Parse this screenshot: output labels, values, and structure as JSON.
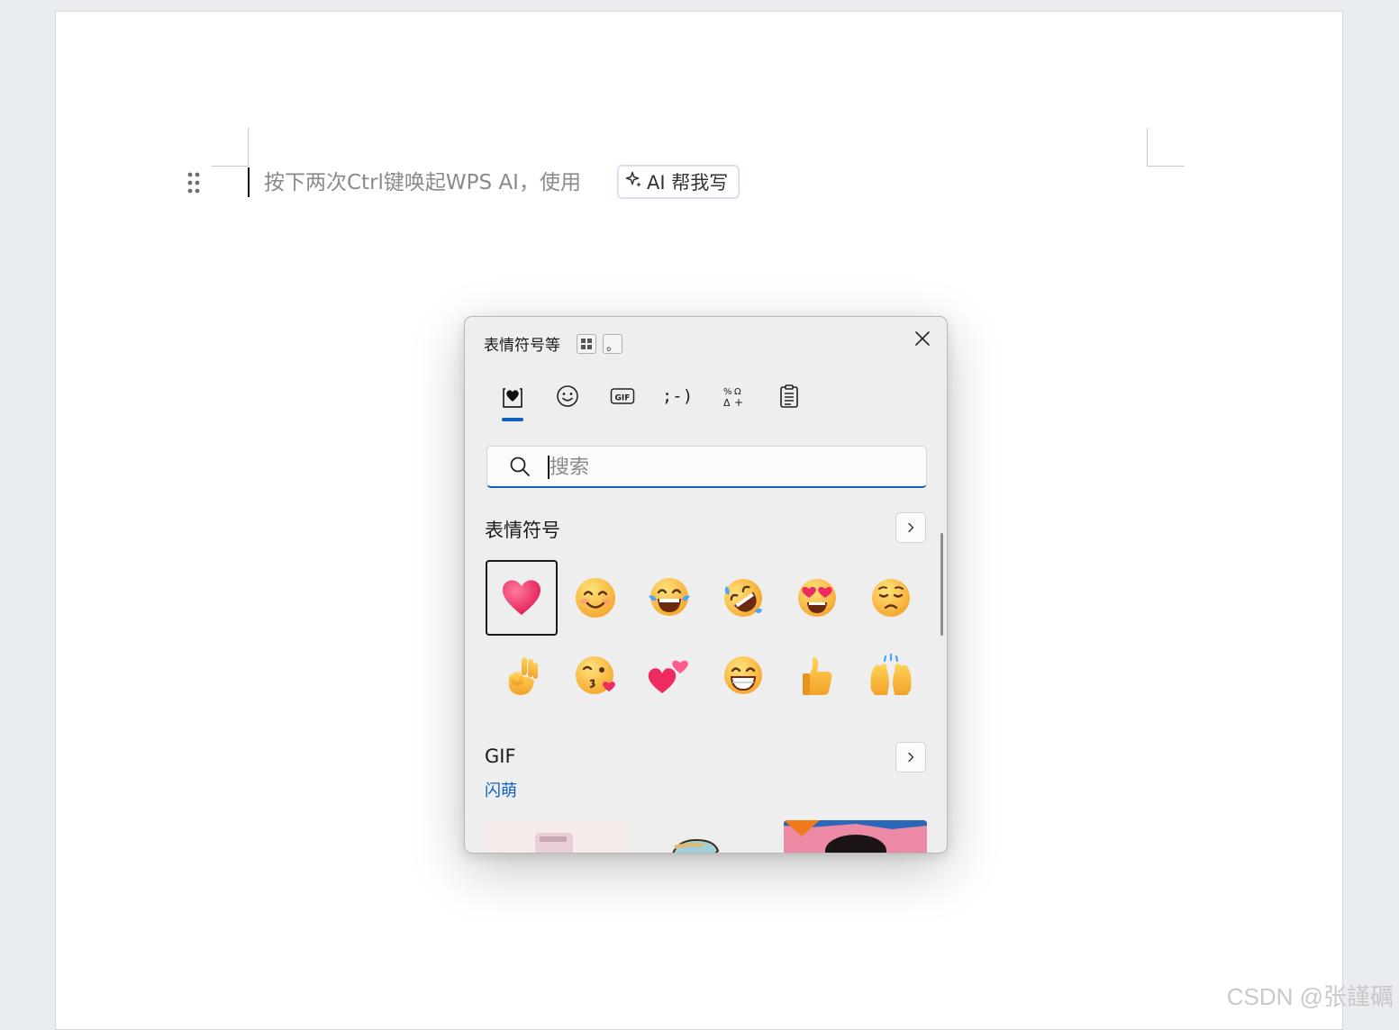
{
  "document": {
    "hint_text": "按下两次Ctrl键唤起WPS AI，使用",
    "ai_button_label": "AI 帮我写"
  },
  "emoji_panel": {
    "title": "表情符号等",
    "mini_buttons": [
      "grid-icon",
      "。"
    ],
    "tabs": [
      {
        "name": "recent",
        "icon": "heart-clipboard-icon",
        "active": true
      },
      {
        "name": "emoji",
        "icon": "smiley-icon",
        "active": false
      },
      {
        "name": "gif",
        "icon": "gif-icon",
        "label": "GIF",
        "active": false
      },
      {
        "name": "kaomoji",
        "icon": "kaomoji-icon",
        "label": ";-)",
        "active": false
      },
      {
        "name": "symbols",
        "icon": "symbols-icon",
        "active": false
      },
      {
        "name": "clipboard",
        "icon": "clipboard-icon",
        "active": false
      }
    ],
    "search_placeholder": "搜索",
    "emoji_section": {
      "title": "表情符号",
      "emojis": [
        {
          "name": "red-heart",
          "char": "❤"
        },
        {
          "name": "smiling-face",
          "char": "😊"
        },
        {
          "name": "tears-of-joy",
          "char": "😂"
        },
        {
          "name": "rolling-on-floor-laughing",
          "char": "🤣"
        },
        {
          "name": "heart-eyes",
          "char": "😍"
        },
        {
          "name": "pleading-face",
          "char": "😔"
        },
        {
          "name": "ok-hand",
          "char": "👌"
        },
        {
          "name": "kissing-face",
          "char": "😘"
        },
        {
          "name": "two-hearts",
          "char": "💕"
        },
        {
          "name": "beaming-face",
          "char": "😁"
        },
        {
          "name": "thumbs-up",
          "char": "👍"
        },
        {
          "name": "raising-hands",
          "char": "🙌"
        }
      ]
    },
    "gif_section": {
      "title": "GIF",
      "subtitle": "闪萌"
    }
  },
  "watermark": "CSDN @张謹礪",
  "colors": {
    "accent": "#0f5fbf",
    "panel_bg": "#eeeeee",
    "page_bg": "#ffffff"
  }
}
